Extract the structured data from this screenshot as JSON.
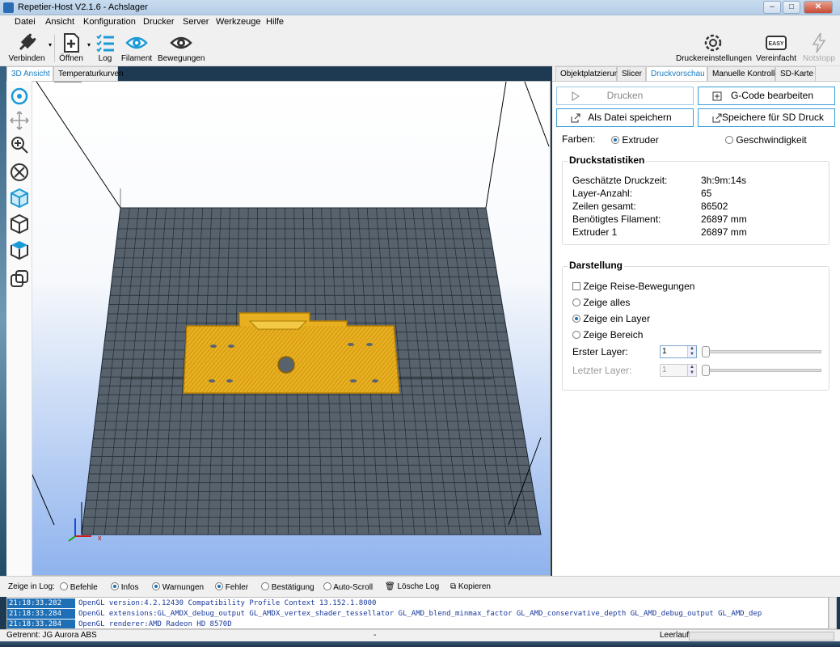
{
  "window": {
    "title": "Repetier-Host V2.1.6 - Achslager",
    "min": "–",
    "max": "□",
    "close": "✕"
  },
  "menu": [
    "Datei",
    "Ansicht",
    "Konfiguration",
    "Drucker",
    "Server",
    "Werkzeuge",
    "Hilfe"
  ],
  "toolbar": {
    "connect": "Verbinden",
    "open": "Öffnen",
    "log": "Log",
    "filament": "Filament",
    "moves": "Bewegungen",
    "printer_settings": "Druckereinstellungen",
    "easy": "Vereinfacht",
    "easy_badge": "EASY",
    "emergency": "Notstopp"
  },
  "left_tabs": {
    "view3d": "3D Ansicht",
    "temp": "Temperaturkurven"
  },
  "right_tabs": [
    "Objektplatzierung",
    "Slicer",
    "Druckvorschau",
    "Manuelle Kontrolle",
    "SD-Karte"
  ],
  "preview": {
    "print": "Drucken",
    "edit_gcode": "G-Code bearbeiten",
    "save_file": "Als Datei speichern",
    "save_sd": "Speichere für SD Druck",
    "colors_label": "Farben:",
    "color_extruder": "Extruder",
    "color_speed": "Geschwindigkeit",
    "stats_title": "Druckstatistiken",
    "stats": [
      {
        "label": "Geschätzte Druckzeit:",
        "value": "3h:9m:14s"
      },
      {
        "label": "Layer-Anzahl:",
        "value": "65"
      },
      {
        "label": "Zeilen gesamt:",
        "value": "86502"
      },
      {
        "label": "Benötigtes Filament:",
        "value": "26897 mm"
      },
      {
        "label": "Extruder 1",
        "value": "26897 mm"
      }
    ],
    "display_title": "Darstellung",
    "show_travel": "Zeige Reise-Bewegungen",
    "show_all": "Zeige alles",
    "show_layer": "Zeige ein Layer",
    "show_range": "Zeige Bereich",
    "first_layer_label": "Erster Layer:",
    "first_layer_value": "1",
    "last_layer_label": "Letzter Layer:",
    "last_layer_value": "1"
  },
  "log": {
    "show_label": "Zeige in Log:",
    "commands": "Befehle",
    "infos": "Infos",
    "warnings": "Warnungen",
    "errors": "Fehler",
    "acks": "Bestätigung",
    "autoscroll": "Auto-Scroll",
    "clear": "Lösche Log",
    "copy": "Kopieren",
    "lines": [
      {
        "ts": "21:18:33.282",
        "msg": "OpenGL version:4.2.12430 Compatibility Profile Context 13.152.1.8000"
      },
      {
        "ts": "21:18:33.284",
        "msg": "OpenGL extensions:GL_AMDX_debug_output GL_AMDX_vertex_shader_tessellator GL_AMD_blend_minmax_factor GL_AMD_conservative_depth GL_AMD_debug_output GL_AMD_dep"
      },
      {
        "ts": "21:18:33.284",
        "msg": "OpenGL renderer:AMD Radeon HD 8570D"
      }
    ]
  },
  "status": {
    "connection": "Getrennt: JG Aurora ABS",
    "middle": "-",
    "idle": "Leerlauf"
  },
  "colors": {
    "accent": "#1a9ad6",
    "grid_fill": "#58626c",
    "grid_line": "#1e2a36",
    "part": "#e8b020"
  }
}
